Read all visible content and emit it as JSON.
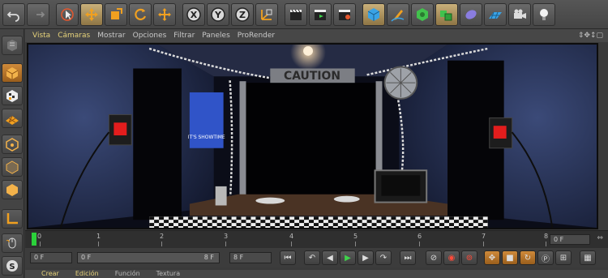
{
  "viewport_menu": {
    "items": [
      "Vista",
      "Cámaras",
      "Mostrar",
      "Opciones",
      "Filtrar",
      "Paneles",
      "ProRender"
    ],
    "nav_icons": "⇕✥↕▢"
  },
  "scene": {
    "caution_text": "CAUTION",
    "poster_text": "IT'S SHOWTIME"
  },
  "timeline": {
    "labels": [
      "0",
      "1",
      "2",
      "3",
      "4",
      "5",
      "6",
      "7",
      "8"
    ],
    "end_field": "0 F"
  },
  "transport": {
    "current_frame": "0 F",
    "range_start": "0 F",
    "range_end": "8 F",
    "max_frame": "8 F"
  },
  "bottom_menu": {
    "items": [
      "Crear",
      "Edición",
      "Función",
      "Textura"
    ]
  },
  "colors": {
    "accent": "#e6d27a",
    "playhead": "#2bd13a",
    "record": "#ff4b3a"
  }
}
